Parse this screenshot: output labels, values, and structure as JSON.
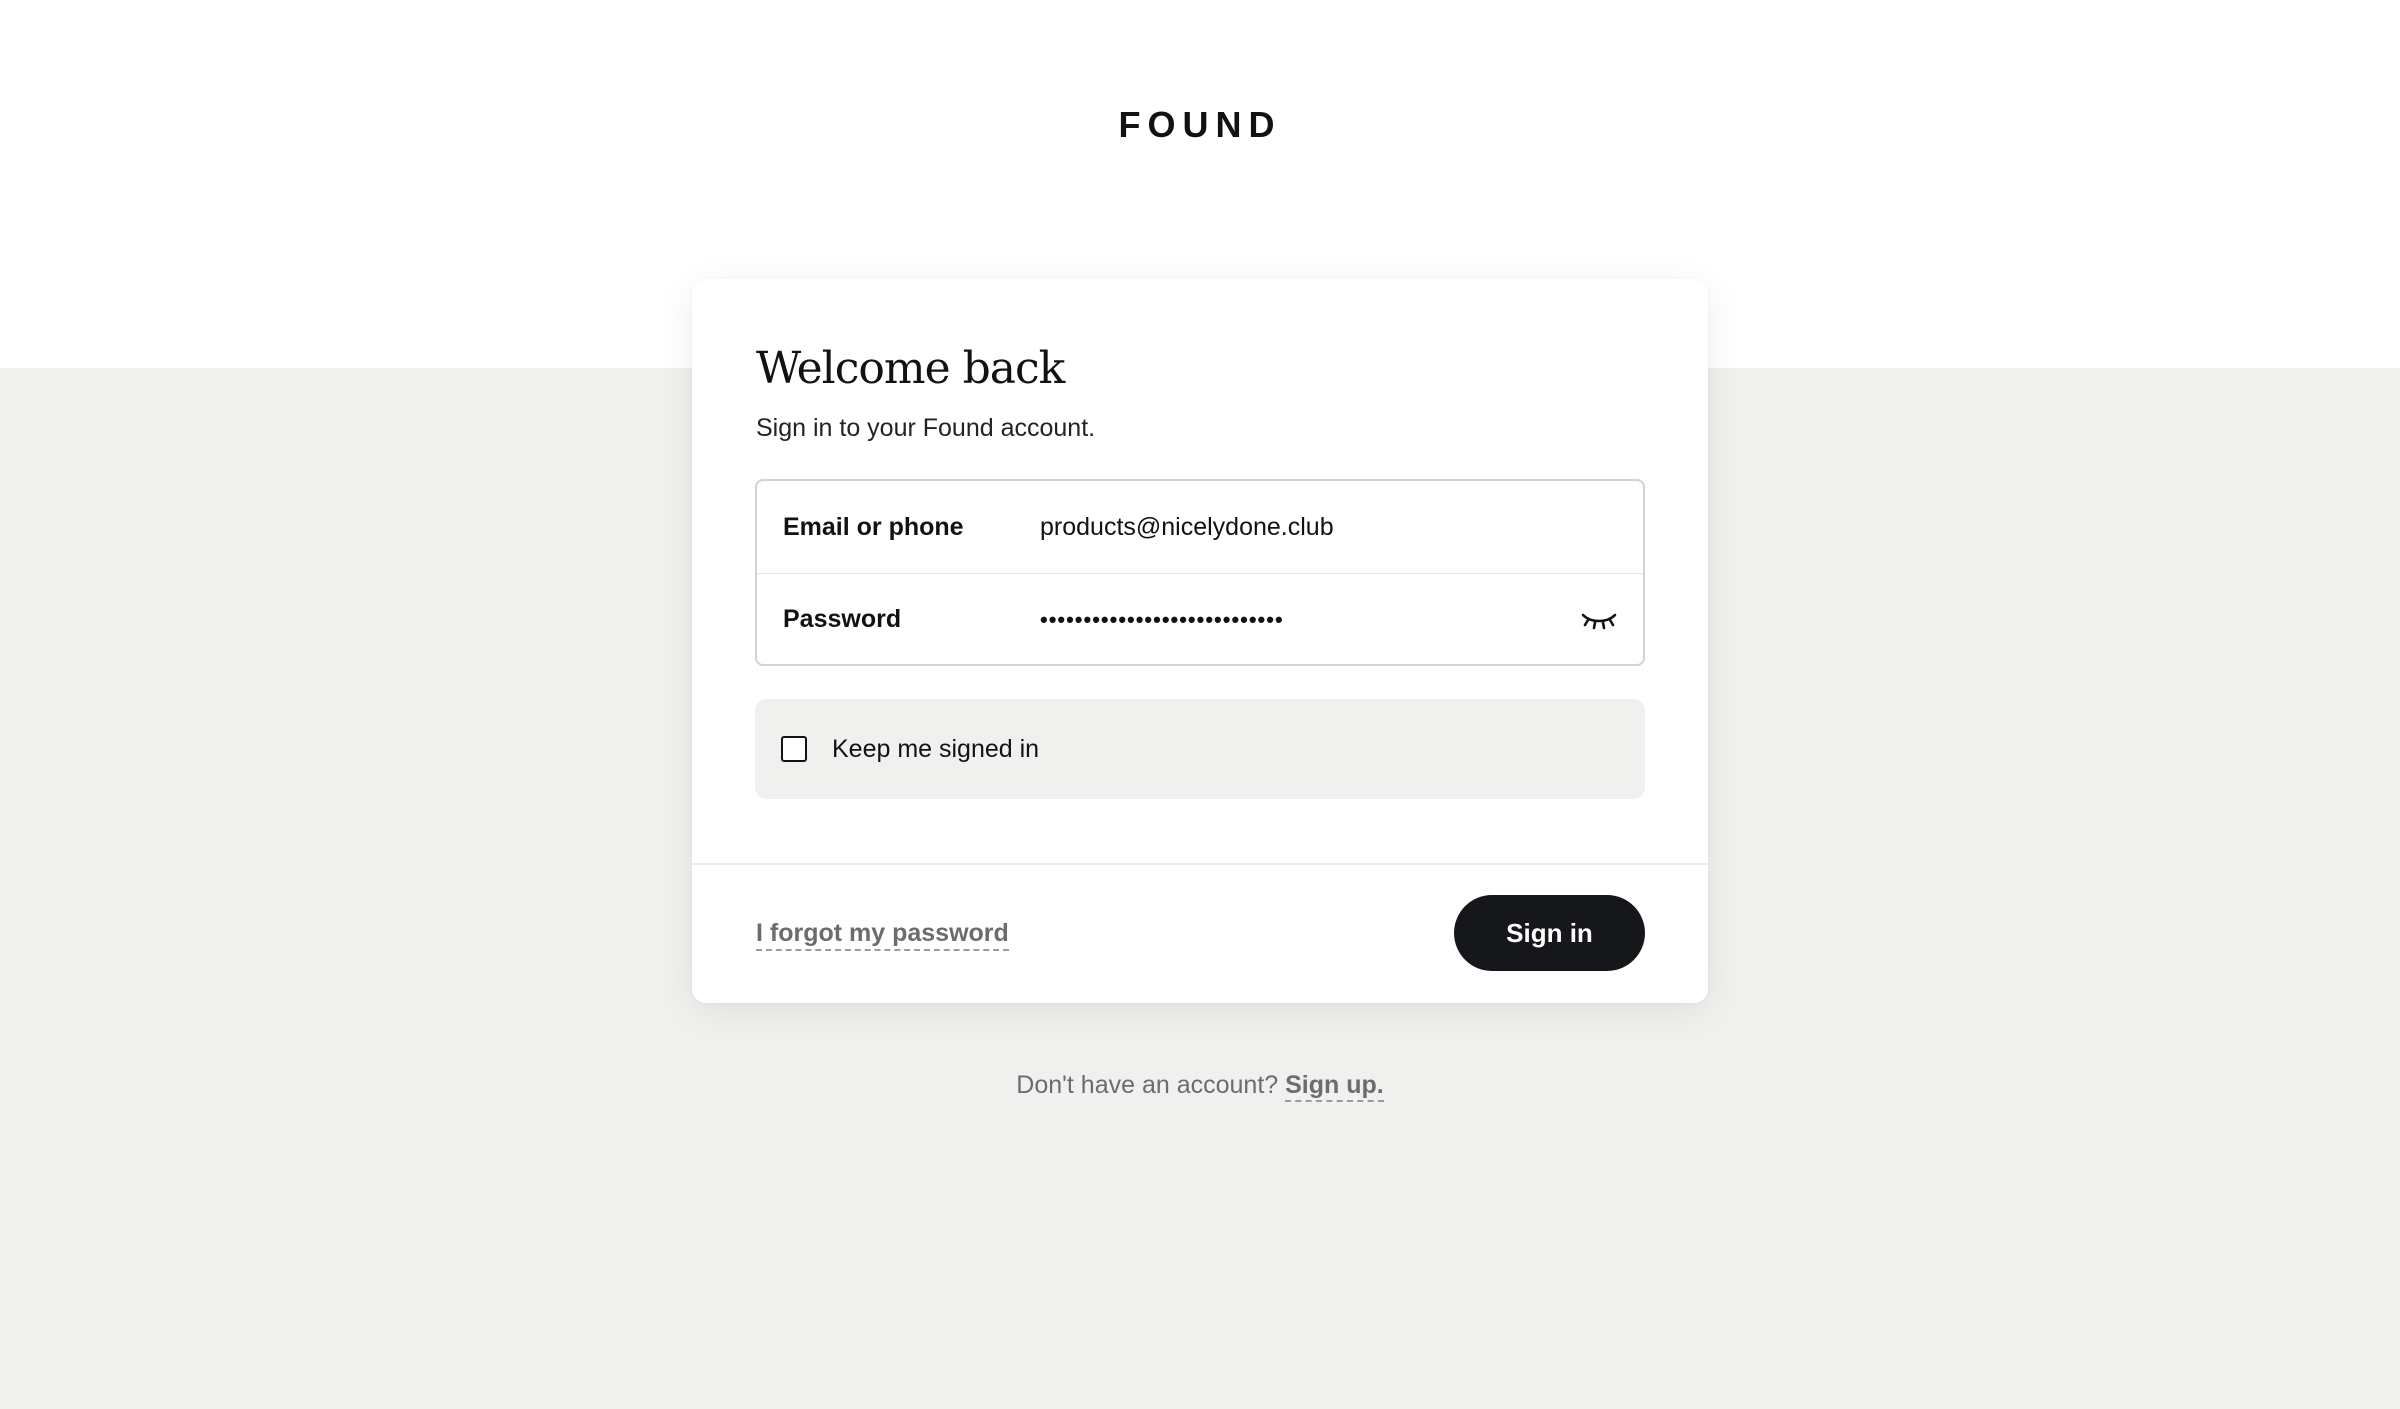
{
  "brand": {
    "logo_text": "FOUND"
  },
  "card": {
    "title": "Welcome back",
    "subtitle": "Sign in to your Found account."
  },
  "fields": {
    "email": {
      "label": "Email or phone",
      "value": "products@nicelydone.club"
    },
    "password": {
      "label": "Password",
      "value": "••••••••••••••••••••••••••••",
      "toggle_icon": "eye-closed-icon"
    }
  },
  "keep_signed_in": {
    "label": "Keep me signed in",
    "checked": false
  },
  "actions": {
    "forgot_label": "I forgot my password",
    "signin_label": "Sign in"
  },
  "footer": {
    "prompt": "Don't have an account?",
    "signup_label": "Sign up."
  },
  "colors": {
    "background_bottom": "#f0f1ee",
    "primary_button": "#16171a",
    "muted_text": "#6b6c6f"
  }
}
